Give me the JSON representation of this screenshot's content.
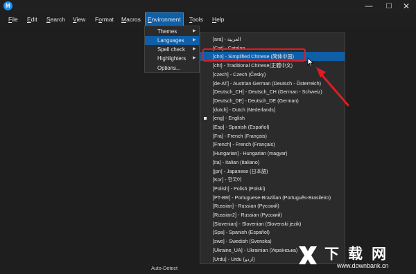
{
  "app": {
    "icon_letter": "M",
    "controls": {
      "minimize": "—",
      "maximize": "☐",
      "close": "✕"
    }
  },
  "menubar": {
    "items": [
      {
        "accel": "F",
        "rest": "ile"
      },
      {
        "accel": "E",
        "rest": "dit"
      },
      {
        "accel": "S",
        "rest": "earch"
      },
      {
        "accel": "V",
        "rest": "iew"
      },
      {
        "accel": "F",
        "rest": "ormat",
        "prefix": ""
      },
      {
        "accel": "M",
        "rest": "acros"
      },
      {
        "accel": "E",
        "rest": "nvironment"
      },
      {
        "accel": "T",
        "rest": "ools"
      },
      {
        "accel": "H",
        "rest": "elp"
      }
    ]
  },
  "environment_menu": {
    "items": [
      {
        "label": "Themes",
        "arrow": "▶"
      },
      {
        "label": "Languages",
        "arrow": "▶"
      },
      {
        "label": "Spell check",
        "arrow": "▶"
      },
      {
        "label": "Highlighters",
        "arrow": "▶"
      },
      {
        "label": "Options..."
      }
    ]
  },
  "languages_menu": {
    "items": [
      "[ara] - العربية",
      "[Cat] - Catalan",
      "[chn] - Simplified Chinese (简体中国)",
      "[cht] - Traditional Chinese(正體中文)",
      "[czech] - Czech (Česky)",
      "[de-AT] - Austrian German (Deutsch - Österreich)",
      "[Deutsch_CH] - Deutsch_CH (German - Schweiz)",
      "[Deutsch_DE] - Deutsch_DE (German)",
      "[dutch] - Dutch (Nederlands)",
      "[eng] - English",
      "[Esp] - Spanish (Español)",
      "[Fra] - French (Français)",
      "[French] - French (Français)",
      "[Hungarian] - Hungarian (magyar)",
      "[ita] - Italian (Italiano)",
      "[jpn] - Japanese (日本語)",
      "[Kor] - 한국어",
      "[Polish] - Polish (Polski)",
      "[PT-BR] - Portuguese-Brazilian (Português-Brasileiro)",
      "[Russian] - Russian (Русский)",
      "[Russian2] - Russian (Русский)",
      "[Slovenian] - Slovenian (Slovenski jezik)",
      "[Spa] - Spanish (Español)",
      "[swe] - Swedish (Svenska)",
      "[Ukraine_UA] - Ukrainian (Українська)",
      "[Urdu] - Urdu (اردو)"
    ],
    "hovered_index": 2,
    "checked_index": 9,
    "autodetect": "Auto-Detect"
  },
  "watermark": {
    "text": "下载网",
    "url": "www.downbank.cn"
  },
  "colors": {
    "highlight": "#0f5fa8",
    "annotation": "#e01b24"
  }
}
